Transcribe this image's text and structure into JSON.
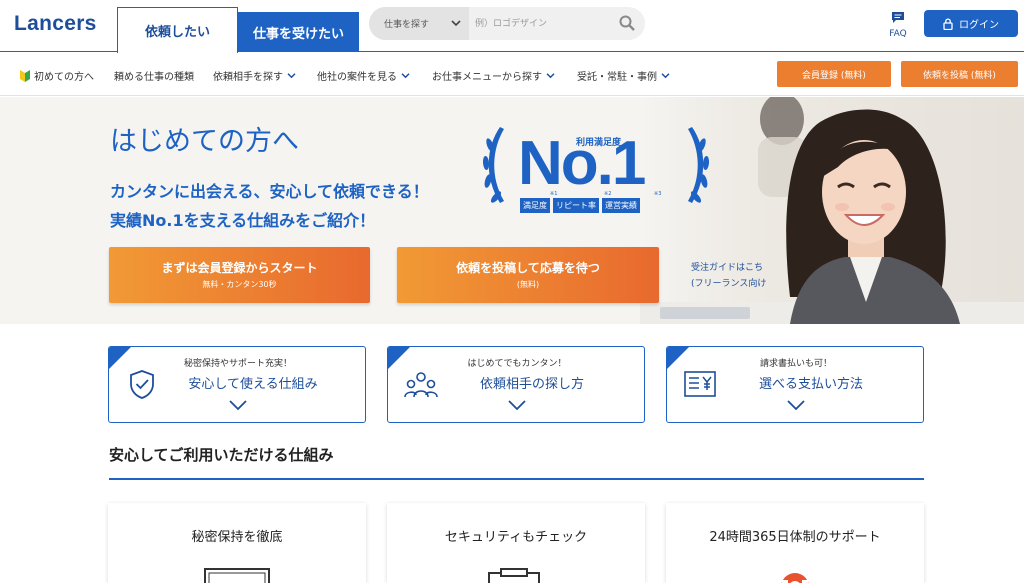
{
  "header": {
    "logo": "Lancers",
    "tab_client": "依頼したい",
    "tab_worker": "仕事を受けたい",
    "search": {
      "category": "仕事を探す",
      "placeholder": "例）ロゴデザイン",
      "icon": "search-icon"
    },
    "faq_label": "FAQ",
    "login_label": "ログイン"
  },
  "subnav": {
    "items": [
      {
        "label": "初めての方へ",
        "icon": "beginner-mark-icon"
      },
      {
        "label": "頼める仕事の種類"
      },
      {
        "label": "依頼相手を探す"
      },
      {
        "label": "他社の案件を見る"
      },
      {
        "label": "お仕事メニューから探す"
      },
      {
        "label": "受託・常駐・事例"
      }
    ],
    "register_label": "会員登録 (無料)",
    "post_label": "依頼を投稿 (無料)"
  },
  "hero": {
    "title": "はじめての方へ",
    "lead_1": "カンタンに出会える、安心して依頼できる！",
    "lead_2": "実績No.1を支える仕組みをご紹介！",
    "badge": {
      "caption": "利用満足度",
      "headline": "No.1",
      "tags": [
        "満足度",
        "リピート率",
        "運営実績"
      ],
      "notes": [
        "※1",
        "※2",
        "※3"
      ]
    },
    "cta_register": {
      "main": "まずは会員登録からスタート",
      "sub": "無料・カンタン30秒"
    },
    "cta_post": {
      "main": "依頼を投稿して応募を待つ",
      "sub": "(無料)"
    },
    "guide_1": "受注ガイドはこち",
    "guide_2": "(フリーランス向け"
  },
  "features": [
    {
      "sub": "秘密保持やサポート充実！",
      "title": "安心して使える仕組み",
      "icon": "shield-check-icon"
    },
    {
      "sub": "はじめてでもカンタン！",
      "title": "依頼相手の探し方",
      "icon": "people-search-icon"
    },
    {
      "sub": "請求書払いも可！",
      "title": "選べる支払い方法",
      "icon": "invoice-yen-icon"
    }
  ],
  "section": {
    "title": "安心してご利用いただける仕組み"
  },
  "cards": [
    {
      "title": "秘密保持を徹底",
      "icon": "document-icon"
    },
    {
      "title": "セキュリティもチェック",
      "icon": "clipboard-icon"
    },
    {
      "title": "24時間365日体制のサポート",
      "icon": "lifebuoy-icon"
    }
  ],
  "colors": {
    "brand_blue": "#1e63c4",
    "cta_orange": "#ec7e30"
  }
}
